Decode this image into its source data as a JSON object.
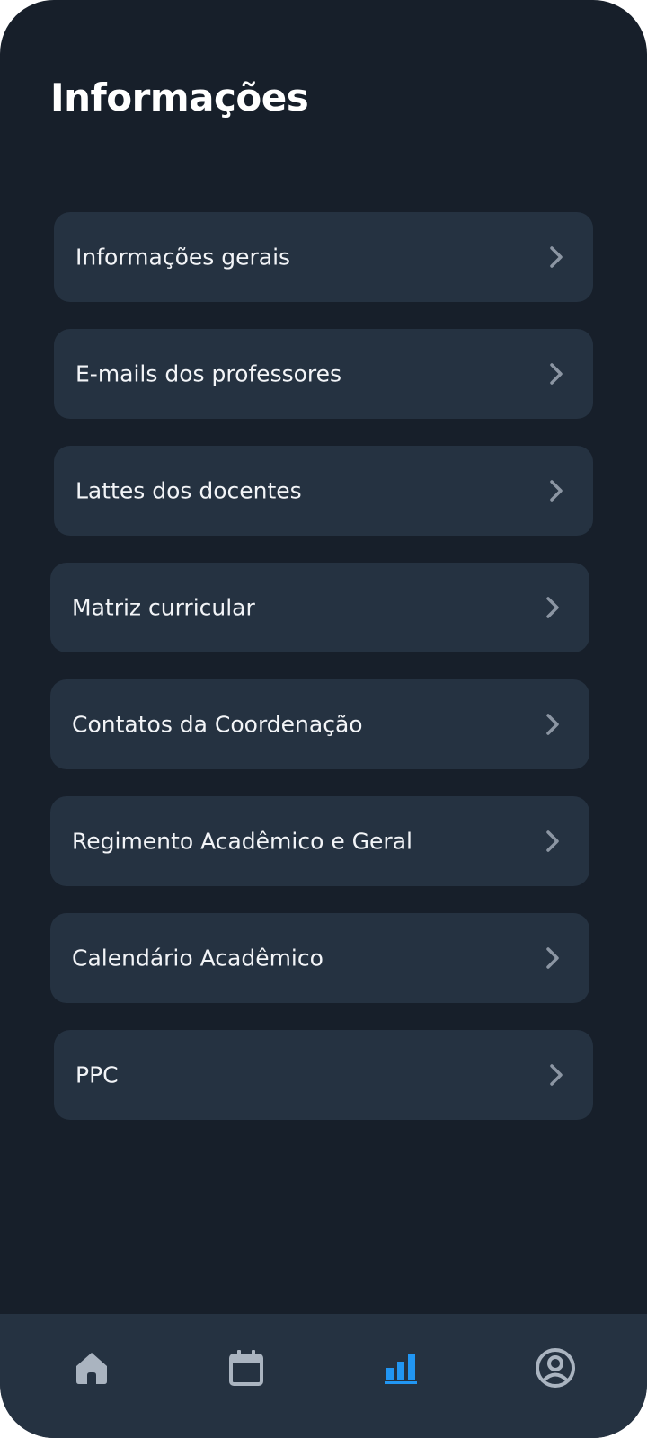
{
  "header": {
    "title": "Informações"
  },
  "menu": {
    "items": [
      {
        "label": "Informações gerais",
        "icon": "chevron-right-icon"
      },
      {
        "label": "E-mails dos professores",
        "icon": "chevron-right-icon"
      },
      {
        "label": "Lattes dos docentes",
        "icon": "chevron-right-icon"
      },
      {
        "label": "Matriz curricular",
        "icon": "chevron-right-icon"
      },
      {
        "label": "Contatos da Coordenação",
        "icon": "chevron-right-icon"
      },
      {
        "label": "Regimento Acadêmico e Geral",
        "icon": "chevron-right-icon"
      },
      {
        "label": "Calendário Acadêmico",
        "icon": "chevron-right-icon"
      },
      {
        "label": "PPC",
        "icon": "chevron-right-icon"
      }
    ]
  },
  "bottom_nav": {
    "items": [
      {
        "icon": "home-icon",
        "active": false
      },
      {
        "icon": "calendar-icon",
        "active": false
      },
      {
        "icon": "bar-chart-icon",
        "active": true
      },
      {
        "icon": "user-profile-icon",
        "active": false
      }
    ]
  },
  "colors": {
    "background": "#171f2a",
    "card": "#253241",
    "text": "#f2f4f7",
    "chevron": "#8c96a3",
    "nav_icon": "#aab4c0",
    "accent": "#2196f3"
  }
}
